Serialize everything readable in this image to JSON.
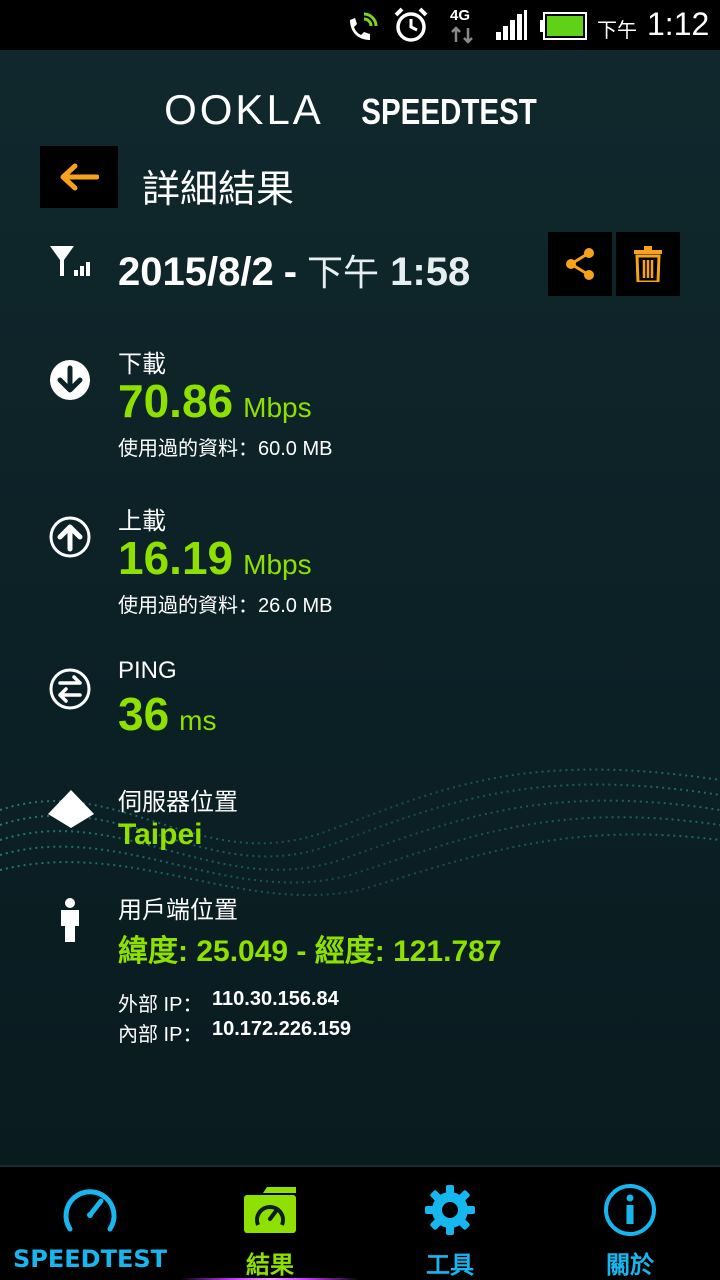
{
  "status_bar": {
    "network": "4G",
    "clock_ampm": "下午",
    "clock_time": "1:12"
  },
  "header": {
    "logo_ookla": "OOKLA",
    "logo_speedtest": "SPEEDTEST"
  },
  "page": {
    "title": "詳細結果"
  },
  "result": {
    "date": "2015/8/2",
    "separator": "-",
    "ampm": "下午",
    "time": "1:58",
    "download": {
      "label": "下載",
      "value": "70.86",
      "unit": "Mbps",
      "data_used": "使用過的資料：60.0 MB"
    },
    "upload": {
      "label": "上載",
      "value": "16.19",
      "unit": "Mbps",
      "data_used": "使用過的資料：26.0 MB"
    },
    "ping": {
      "label": "PING",
      "value": "36",
      "unit": "ms"
    },
    "server": {
      "label": "伺服器位置",
      "value": "Taipei"
    },
    "client": {
      "label": "用戶端位置",
      "coords": "緯度: 25.049 - 經度: 121.787",
      "external_ip_label": "外部 IP：",
      "external_ip": "110.30.156.84",
      "internal_ip_label": "內部 IP：",
      "internal_ip": "10.172.226.159"
    }
  },
  "tabs": [
    {
      "label": "SPEEDTEST",
      "icon": "speedometer-icon",
      "active": false
    },
    {
      "label": "結果",
      "icon": "results-folder-icon",
      "active": true
    },
    {
      "label": "工具",
      "icon": "gear-icon",
      "active": false
    },
    {
      "label": "關於",
      "icon": "info-icon",
      "active": false
    }
  ],
  "colors": {
    "accent_green": "#8ee000",
    "accent_blue": "#16b6ee",
    "accent_orange": "#f7a21b",
    "background": "#0b1d21"
  }
}
